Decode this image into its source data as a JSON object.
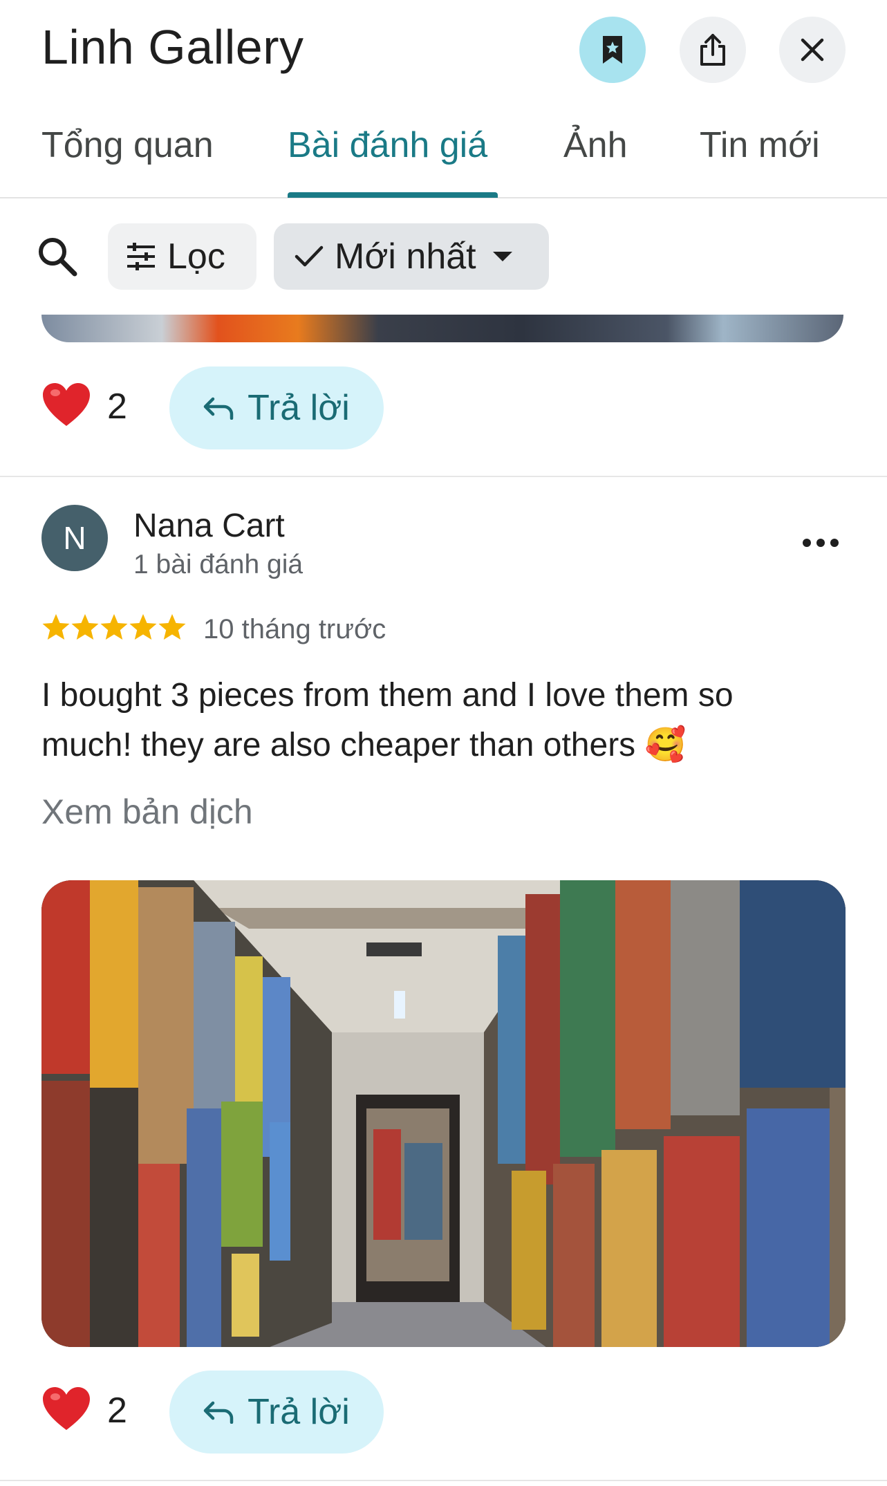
{
  "header": {
    "title": "Linh Gallery",
    "save_icon": "bookmark-icon",
    "share_icon": "share-icon",
    "close_icon": "close-icon"
  },
  "tabs": [
    {
      "label": "Tổng quan",
      "active": false
    },
    {
      "label": "Bài đánh giá",
      "active": true
    },
    {
      "label": "Ảnh",
      "active": false
    },
    {
      "label": "Tin mới",
      "active": false
    }
  ],
  "filters": {
    "search_icon": "search-icon",
    "filter_label": "Lọc",
    "sort_label": "Mới nhất"
  },
  "previous_review": {
    "like_count": "2",
    "reply_label": "Trả lời"
  },
  "review": {
    "avatar_letter": "N",
    "author": "Nana Cart",
    "author_sub": "1 bài đánh giá",
    "rating": 5,
    "time": "10 tháng trước",
    "text": "I bought 3 pieces from them and I love them so much! they are also cheaper than others 🥰",
    "translate_label": "Xem bản dịch",
    "like_count": "2",
    "reply_label": "Trả lời"
  },
  "colors": {
    "accent": "#1a7a86",
    "reply_bg": "#d6f3fa",
    "save_bg": "#a8e3ef",
    "star": "#f6b400",
    "heart": "#e0242b",
    "avatar_bg": "#45606b"
  }
}
